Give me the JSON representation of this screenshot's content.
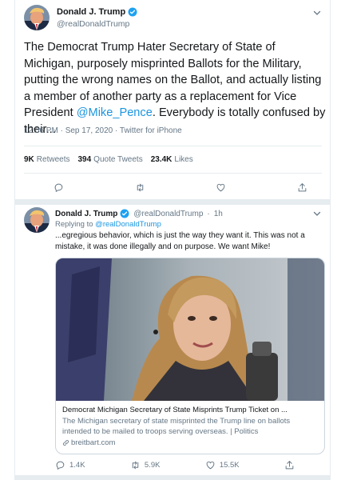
{
  "tweet1": {
    "author_name": "Donald J. Trump",
    "author_handle": "@realDonaldTrump",
    "text_main": "The Democrat Trump Hater Secretary of State of Michigan, purposely misprinted Ballots for the Military, putting the wrong names on the Ballot, and actually listing a member of another party as a replacement for Vice President ",
    "mention": "@Mike_Pence",
    "text_tail": ". Everybody is totally confused by their...",
    "timestamp": "12:06 PM · Sep 17, 2020 · Twitter for iPhone",
    "stats": {
      "retweets_count": "9K",
      "retweets_label": "Retweets",
      "quotes_count": "394",
      "quotes_label": "Quote Tweets",
      "likes_count": "23.4K",
      "likes_label": "Likes"
    }
  },
  "tweet2": {
    "author_name": "Donald J. Trump",
    "author_handle": "@realDonaldTrump",
    "separator": "·",
    "time_ago": "1h",
    "replying_prefix": "Replying to",
    "replying_handle": "@realDonaldTrump",
    "text": "...egregious behavior, which is just the way they want it. This was not a mistake, it was done illegally and on purpose. We want Mike!",
    "card": {
      "title": "Democrat Michigan Secretary of State Misprints Trump Ticket on ...",
      "description": "The Michigan secretary of state misprinted the Trump line on ballots intended to be mailed to troops serving overseas. | Politics",
      "domain": "breitbart.com"
    },
    "actions": {
      "replies": "1.4K",
      "retweets": "5.9K",
      "likes": "15.5K"
    }
  },
  "colors": {
    "link": "#1b95e0",
    "verified": "#1da1f2",
    "secondary_text": "#657786",
    "border": "#e6ecf0"
  },
  "icons": [
    "verified-badge-icon",
    "chevron-down-icon",
    "reply-icon",
    "retweet-icon",
    "like-icon",
    "share-icon",
    "link-icon"
  ]
}
